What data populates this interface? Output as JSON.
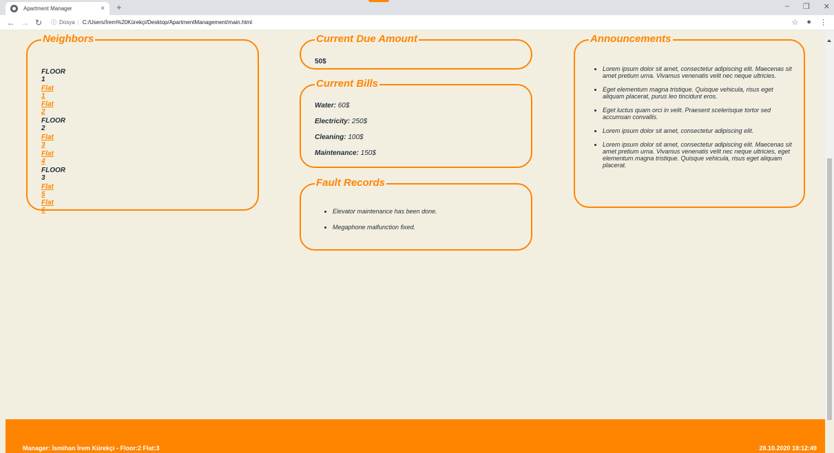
{
  "browser": {
    "tab_title": "Apartment Manager",
    "tab_close": "×",
    "new_tab": "+",
    "url_prefix": "Dosya",
    "url": "C:/Users/İrem%20Kürekçi/Desktop/ApartmentManagement/main.html",
    "win_min": "–",
    "win_restore": "❐",
    "win_close": "✕"
  },
  "neighbors": {
    "title": "Neighbors",
    "floors": [
      {
        "label": "FLOOR 1",
        "flats": [
          "Flat 1",
          "Flat 2"
        ]
      },
      {
        "label": "FLOOR 2",
        "flats": [
          "Flat 3",
          "Flat 4"
        ]
      },
      {
        "label": "FLOOR 3",
        "flats": [
          "Flat 5",
          "Flat 6"
        ]
      }
    ]
  },
  "due": {
    "title": "Current Due Amount",
    "amount": "50$"
  },
  "bills": {
    "title": "Current Bills",
    "items": [
      {
        "label": "Water:",
        "value": " 60$"
      },
      {
        "label": "Electricity:",
        "value": " 250$"
      },
      {
        "label": "Cleaning:",
        "value": " 100$"
      },
      {
        "label": "Maintenance:",
        "value": " 150$"
      }
    ]
  },
  "faults": {
    "title": "Fault Records",
    "items": [
      "Elevator maintenance has been done.",
      "Megaphone malfunction fixed."
    ]
  },
  "announcements": {
    "title": "Announcements",
    "items": [
      "Lorem ipsum dolor sit amet, consectetur adipiscing elit. Maecenas sit amet pretium urna. Vivamus venenatis velit nec neque ultricies.",
      "Eget elementum magna tristique. Quisque vehicula, risus eget aliquam placerat, purus leo tincidunt eros.",
      "Eget luctus quam orci in velit. Praesent scelerisque tortor sed accumsan convallis.",
      "Lorem ipsum dolor sit amet, consectetur adipiscing elit.",
      "Lorem ipsum dolor sit amet, consectetur adipiscing elit. Maecenas sit amet pretium urna. Vivamus venenatis velit nec neque ultricies, eget elementum magna tristique. Quisque vehicula, risus eget aliquam placerat."
    ]
  },
  "footer": {
    "manager": "Manager: İsmihan İrem Kürekçi - Floor:2 Flat:3",
    "datetime": "28.10.2020 18:12:49"
  },
  "colors": {
    "accent": "#ff8400",
    "background": "#f3efe0",
    "text": "#1f2a3a"
  }
}
